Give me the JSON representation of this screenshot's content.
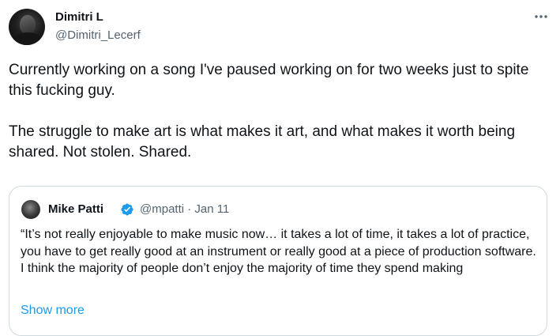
{
  "author": {
    "display_name": "Dimitri L",
    "handle": "@Dimitri_Lecerf",
    "avatar_icon": "profile-photo"
  },
  "more_icon": "ellipsis-icon",
  "body": {
    "paragraph_1": "Currently working on a song I've paused working on for two weeks just to spite this fucking guy.",
    "paragraph_2": "The struggle to make art is what makes it art, and what makes it worth being shared. Not stolen. Shared."
  },
  "quote": {
    "display_name": "Mike Patti",
    "verified": true,
    "verified_color": "#1d9bf0",
    "handle_date": "@mpatti · Jan 11",
    "text": "“It’s not really enjoyable to make music now… it takes a lot of time, it takes a lot of practice, you have to get really good at an instrument or really good at a piece of production software. I think the majority of people don’t enjoy the majority of time they spend making",
    "show_more": "Show more"
  },
  "colors": {
    "text_primary": "#0f1419",
    "text_secondary": "#536471",
    "link": "#1d9bf0",
    "border": "#cfd9de"
  }
}
